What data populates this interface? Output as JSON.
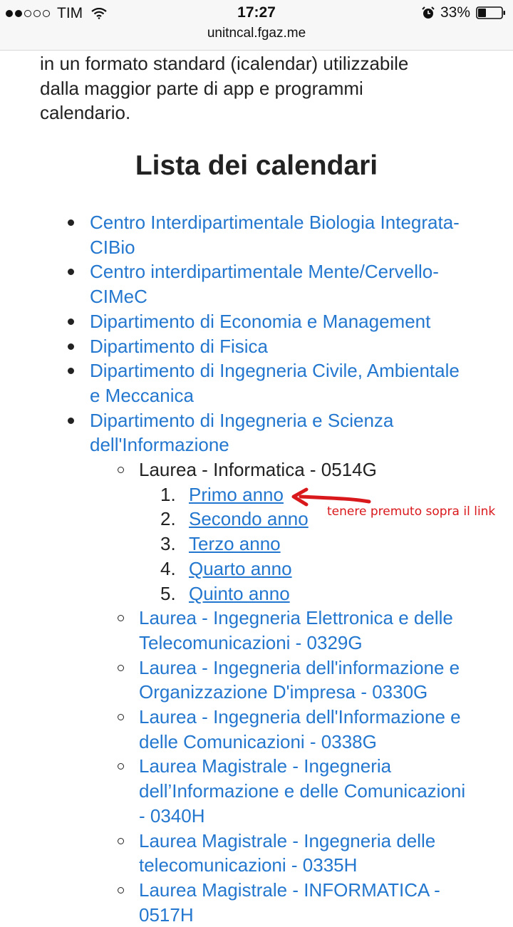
{
  "status_bar": {
    "signal_dots": [
      true,
      true,
      false,
      false,
      false
    ],
    "carrier": "TIM",
    "time": "17:27",
    "battery": "33%"
  },
  "url_bar": {
    "url": "unitncal.fgaz.me"
  },
  "intro_text": [
    "in un formato standard (icalendar) utilizzabile",
    "dalla maggior parte di app e programmi",
    "calendario."
  ],
  "heading": "Lista dei calendari",
  "departments": [
    "Centro Interdipartimentale Biologia Integrata- CIBio",
    "Centro interdipartimentale Mente/Cervello-CIMeC",
    "Dipartimento di Economia e Management",
    "Dipartimento di Fisica",
    "Dipartimento di Ingegneria Civile, Ambientale e Meccanica",
    "Dipartimento di Ingegneria e Scienza dell'Informazione"
  ],
  "courses": [
    "Laurea - Informatica - 0514G",
    "Laurea - Ingegneria Elettronica e delle Telecomunicazioni - 0329G",
    "Laurea - Ingegneria dell'informazione e Organizzazione D'impresa - 0330G",
    "Laurea - Ingegneria dell'Informazione e delle Comunicazioni - 0338G",
    "Laurea Magistrale - Ingegneria dell’Informazione e delle Comunicazioni - 0340H",
    "Laurea Magistrale - Ingegneria delle telecomunicazioni - 0335H",
    "Laurea Magistrale - INFORMATICA - 0517H"
  ],
  "years": [
    {
      "num": "1.",
      "label": "Primo anno"
    },
    {
      "num": "2.",
      "label": "Secondo anno"
    },
    {
      "num": "3.",
      "label": "Terzo anno"
    },
    {
      "num": "4.",
      "label": "Quarto anno"
    },
    {
      "num": "5.",
      "label": "Quinto anno"
    }
  ],
  "annotation": "tenere premuto sopra il link",
  "colors": {
    "link": "#2477cf",
    "annotation": "#d9181c"
  }
}
